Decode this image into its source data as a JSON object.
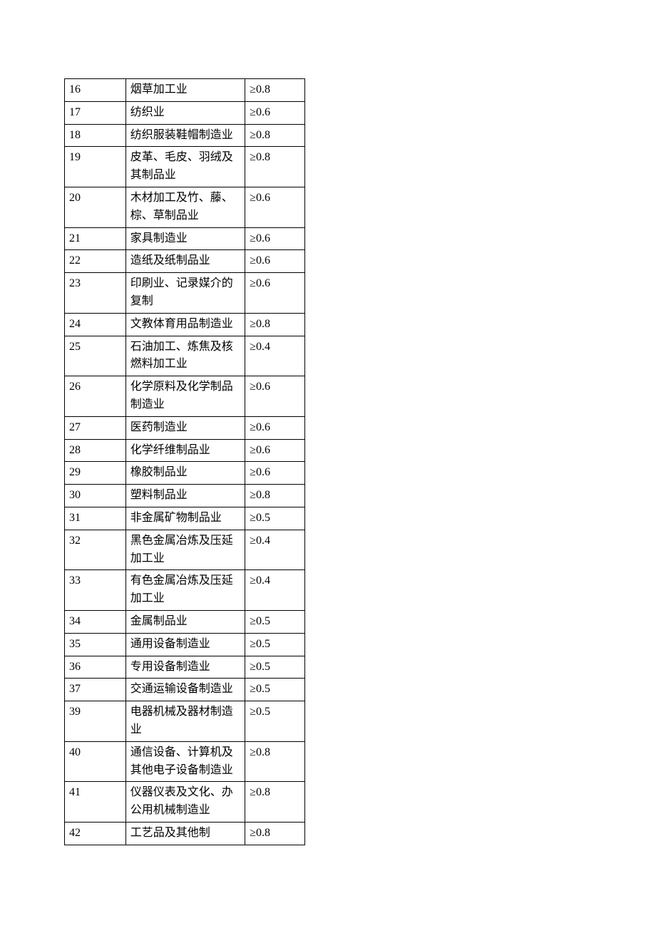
{
  "rows": [
    {
      "id": "16",
      "name": "烟草加工业",
      "val": "≥0.8"
    },
    {
      "id": "17",
      "name": "纺织业",
      "val": "≥0.6"
    },
    {
      "id": "18",
      "name": "纺织服装鞋帽制造业",
      "val": "≥0.8"
    },
    {
      "id": "19",
      "name": "皮革、毛皮、羽绒及其制品业",
      "val": "≥0.8"
    },
    {
      "id": "20",
      "name": "木材加工及竹、藤、棕、草制品业",
      "val": "≥0.6"
    },
    {
      "id": "21",
      "name": "家具制造业",
      "val": "≥0.6"
    },
    {
      "id": "22",
      "name": "造纸及纸制品业",
      "val": "≥0.6"
    },
    {
      "id": "23",
      "name": "印刷业、记录媒介的复制",
      "val": "≥0.6"
    },
    {
      "id": "24",
      "name": "文教体育用品制造业",
      "val": "≥0.8"
    },
    {
      "id": "25",
      "name": "石油加工、炼焦及核燃料加工业",
      "val": "≥0.4"
    },
    {
      "id": "26",
      "name": "化学原料及化学制品制造业",
      "val": "≥0.6"
    },
    {
      "id": "27",
      "name": "医药制造业",
      "val": "≥0.6"
    },
    {
      "id": "28",
      "name": "化学纤维制品业",
      "val": "≥0.6"
    },
    {
      "id": "29",
      "name": "橡胶制品业",
      "val": "≥0.6"
    },
    {
      "id": "30",
      "name": "塑料制品业",
      "val": "≥0.8"
    },
    {
      "id": "31",
      "name": "非金属矿物制品业",
      "val": "≥0.5"
    },
    {
      "id": "32",
      "name": "黑色金属冶炼及压延加工业",
      "val": "≥0.4"
    },
    {
      "id": "33",
      "name": "有色金属冶炼及压延加工业",
      "val": "≥0.4"
    },
    {
      "id": "34",
      "name": "金属制品业",
      "val": "≥0.5"
    },
    {
      "id": "35",
      "name": "通用设备制造业",
      "val": "≥0.5"
    },
    {
      "id": "36",
      "name": "专用设备制造业",
      "val": "≥0.5"
    },
    {
      "id": "37",
      "name": "交通运输设备制造业",
      "val": "≥0.5"
    },
    {
      "id": "39",
      "name": "电器机械及器材制造业",
      "val": "≥0.5"
    },
    {
      "id": "40",
      "name": "通信设备、计算机及其他电子设备制造业",
      "val": "≥0.8"
    },
    {
      "id": "41",
      "name": "仪器仪表及文化、办公用机械制造业",
      "val": "≥0.8"
    },
    {
      "id": "42",
      "name": "工艺品及其他制",
      "val": "≥0.8"
    }
  ]
}
